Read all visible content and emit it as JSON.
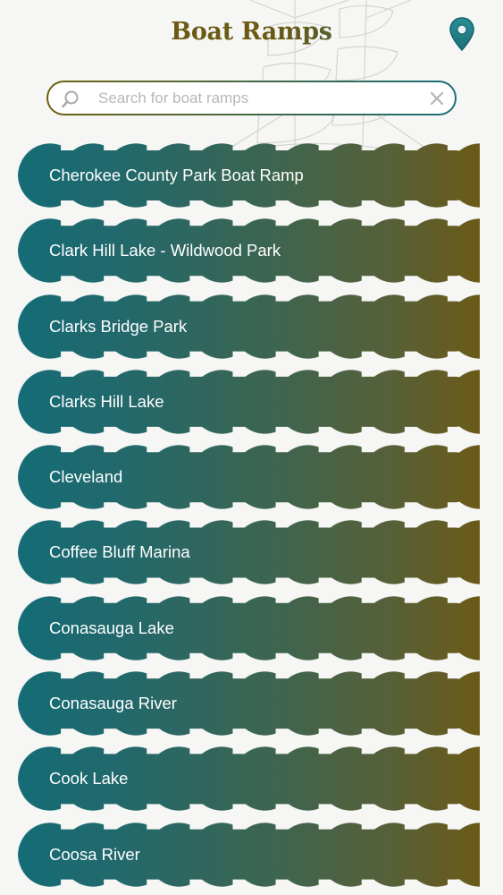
{
  "header": {
    "title": "Boat Ramps",
    "location_icon": "map-pin-icon",
    "title_gradient_colors": [
      "#6e5a10",
      "#1f6f78"
    ]
  },
  "search": {
    "placeholder": "Search for boat ramps",
    "value": "",
    "search_icon": "magnifier-icon",
    "clear_icon": "close-icon"
  },
  "colors": {
    "item_gradient_start": "#146c76",
    "item_gradient_end": "#6b5a18",
    "item_text": "#ffffff",
    "background": "#f6f6f5"
  },
  "ramps": [
    "Cherokee County Park Boat Ramp",
    "Clark Hill Lake - Wildwood Park",
    "Clarks Bridge Park",
    "Clarks Hill Lake",
    "Cleveland",
    "Coffee Bluff Marina",
    "Conasauga Lake",
    "Conasauga River",
    "Cook Lake",
    "Coosa River"
  ]
}
